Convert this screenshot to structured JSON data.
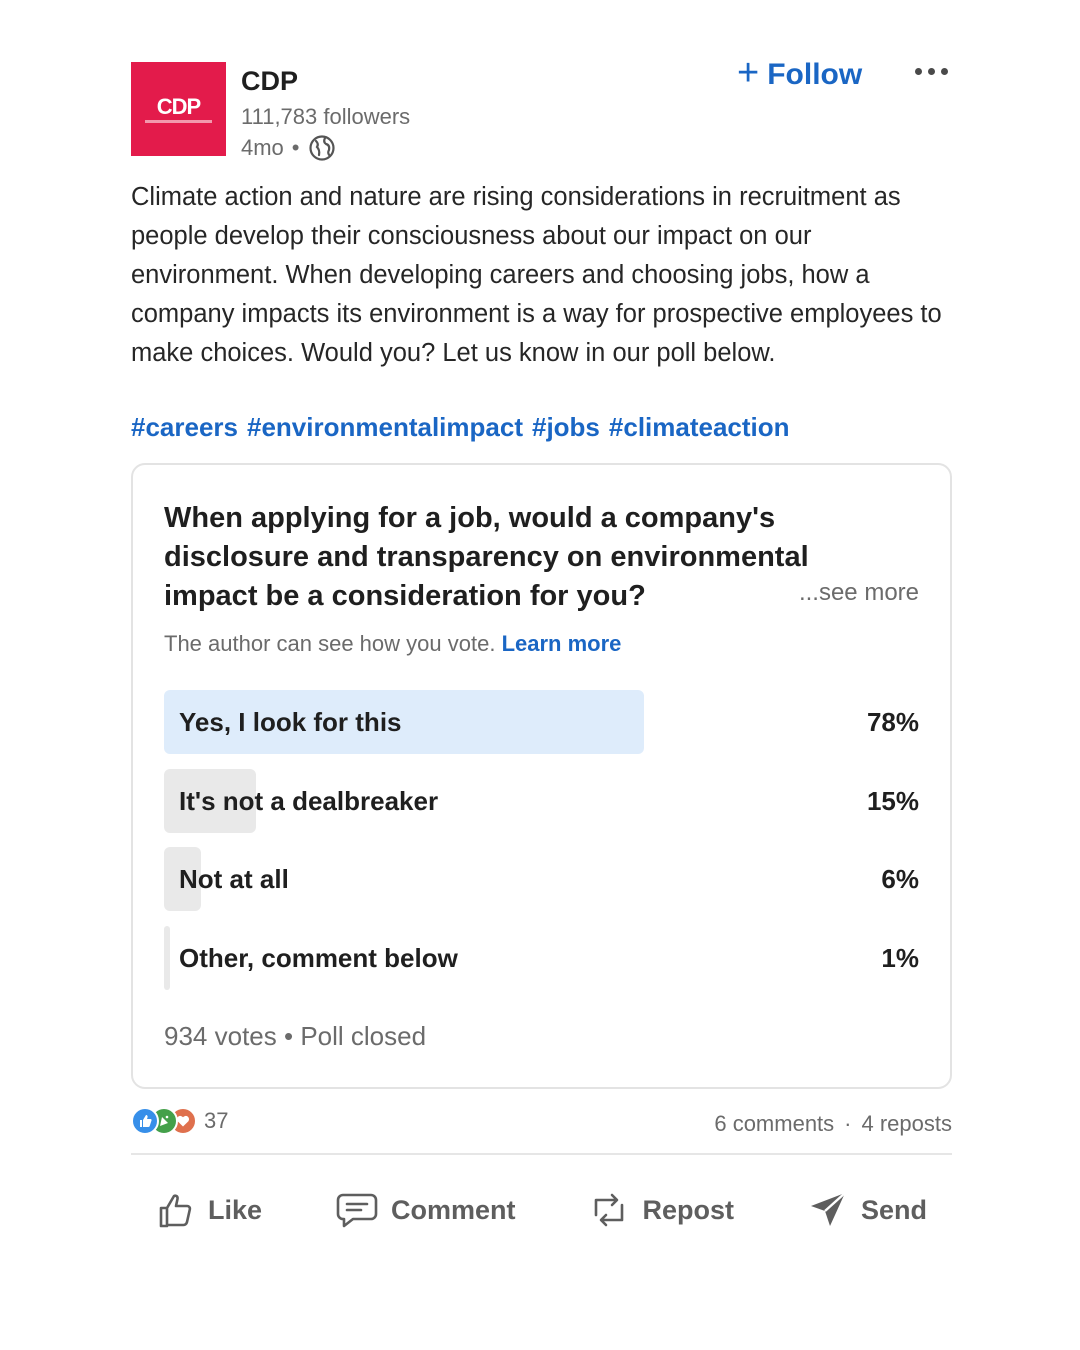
{
  "post": {
    "author": "CDP",
    "logo_text": "CDP",
    "followers": "111,783 followers",
    "age": "4mo",
    "separator": "•",
    "follow_label": "Follow",
    "body": "Climate action and nature are rising considerations in recruitment as people develop their consciousness about our impact on our environment. When developing careers and choosing jobs, how a company impacts its environment is a way for prospective employees to make choices. Would you? Let us know in our poll below.",
    "hashtags": [
      "#careers",
      "#environmentalimpact",
      "#jobs",
      "#climateaction"
    ]
  },
  "poll": {
    "question": "When applying for a job, would a company's disclosure and transparency on environmental impact be a consideration for you?",
    "see_more": "...see more",
    "notice": "The author can see how you vote.",
    "learn_more": "Learn more",
    "options": [
      {
        "label": "Yes, I look for this",
        "percent_text": "78%",
        "share": 0.78,
        "selected": true
      },
      {
        "label": "It's not a dealbreaker",
        "percent_text": "15%",
        "share": 0.15,
        "selected": false
      },
      {
        "label": "Not at all",
        "percent_text": "6%",
        "share": 0.06,
        "selected": false
      },
      {
        "label": "Other, comment below",
        "percent_text": "1%",
        "share": 0.01,
        "selected": false
      }
    ],
    "votes": "934 votes",
    "status": "Poll closed"
  },
  "social": {
    "reaction_count": "37",
    "comments": "6 comments",
    "reposts": "4 reposts",
    "dot": "·"
  },
  "actions": {
    "like": "Like",
    "comment": "Comment",
    "repost": "Repost",
    "send": "Send"
  },
  "colors": {
    "brand_red": "#e31b4b",
    "link_blue": "#1a66c4",
    "selected_fill": "#deecfb",
    "option_fill": "#e9e9e9"
  }
}
